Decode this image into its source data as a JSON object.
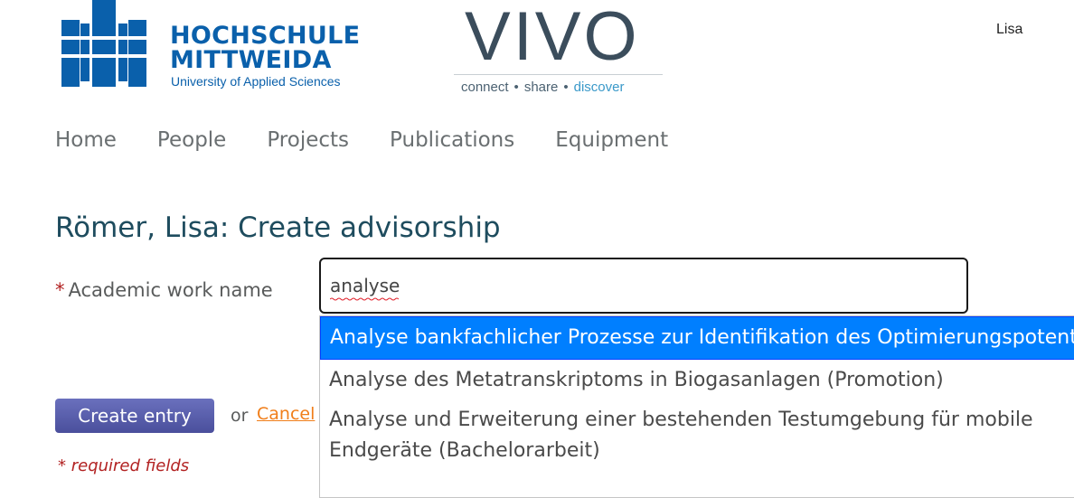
{
  "header": {
    "university_line1": "HOCHSCHULE",
    "university_line2": "MITTWEIDA",
    "university_sub": "University of Applied Sciences",
    "vivo_word": "VIVO",
    "vivo_tag_connect": "connect",
    "vivo_tag_share": "share",
    "vivo_tag_discover": "discover",
    "user_name": "Lisa"
  },
  "nav": {
    "items": [
      "Home",
      "People",
      "Projects",
      "Publications",
      "Equipment"
    ]
  },
  "page": {
    "title": "Römer, Lisa: Create advisorship"
  },
  "form": {
    "required_star": "*",
    "field_label": "Academic work name",
    "field_value": "analyse",
    "create_label": "Create entry",
    "or_text": "or",
    "cancel_label": "Cancel",
    "required_note": "* required fields"
  },
  "autocomplete": {
    "items": [
      "Analyse bankfachlicher Prozesse zur Identifikation des Optimierungspotentials",
      "Analyse des Metatranskriptoms in Biogasanlagen (Promotion)",
      "Analyse und Erweiterung einer bestehenden Testumgebung für mobile Endgeräte (Bachelorarbeit)"
    ]
  },
  "colors": {
    "brand_blue": "#0a60ab",
    "title_color": "#1e4c5e",
    "button": "#5a5fac",
    "cancel": "#f07e1a",
    "required": "#b22222",
    "ac_highlight": "#007fff"
  }
}
